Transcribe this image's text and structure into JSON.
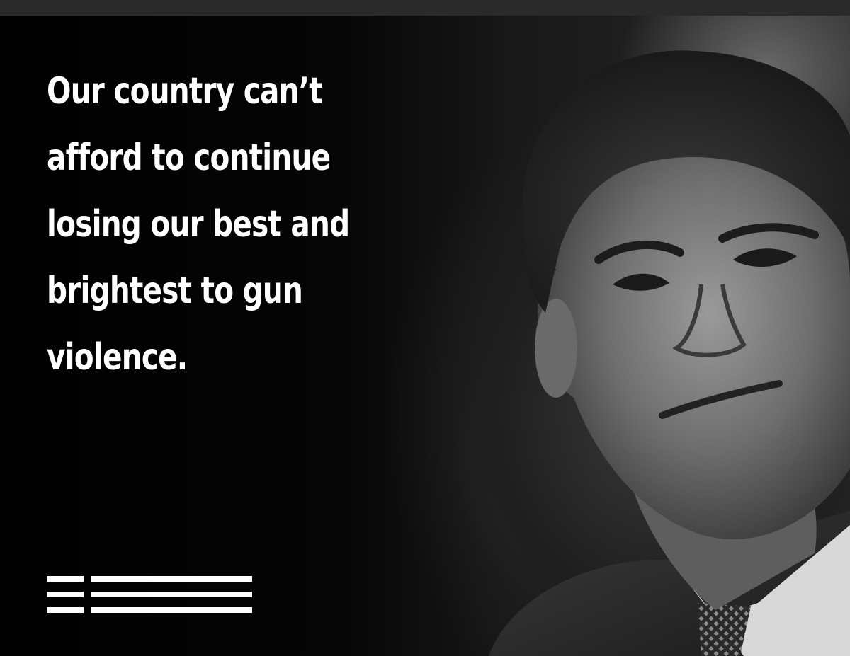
{
  "quote": {
    "lines": [
      "Our country can’t",
      "afford to continue",
      "losing our best and",
      "brightest to gun",
      "violence."
    ]
  },
  "image": {
    "subject": "portrait-photo",
    "style": "black-and-white"
  },
  "logo": {
    "icon": "three-stripe-logo-icon",
    "color": "#ffffff"
  }
}
